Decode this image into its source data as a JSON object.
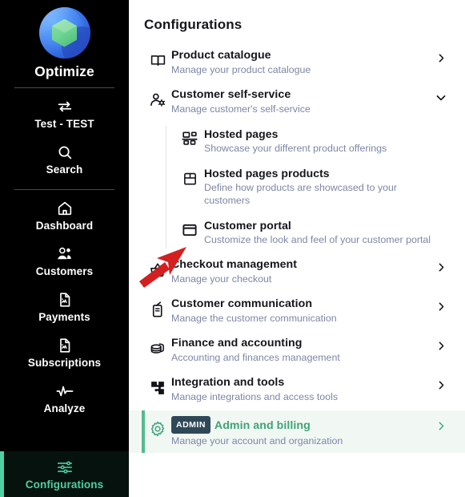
{
  "sidebar": {
    "brand": {
      "name": "Optimize",
      "logo_icon": "optimize-logo",
      "logo_colors": {
        "outer": "#3f7ff0",
        "inner": "#6ed592"
      }
    },
    "items": [
      {
        "label": "Test - TEST",
        "icon": "swap-arrows-icon",
        "active": false
      },
      {
        "label": "Search",
        "icon": "search-icon",
        "active": false
      },
      {
        "label": "Dashboard",
        "icon": "home-icon",
        "active": false
      },
      {
        "label": "Customers",
        "icon": "users-icon",
        "active": false
      },
      {
        "label": "Payments",
        "icon": "document-chart-icon",
        "active": false
      },
      {
        "label": "Subscriptions",
        "icon": "document-chart-icon",
        "active": false
      },
      {
        "label": "Analyze",
        "icon": "pulse-icon",
        "active": false
      },
      {
        "label": "Configurations",
        "icon": "sliders-icon",
        "active": true
      }
    ],
    "active_color": "#4fcfa4",
    "background": "#000000"
  },
  "main": {
    "title": "Configurations",
    "rows": [
      {
        "title": "Product catalogue",
        "subtitle": "Manage your product catalogue",
        "icon": "book-icon",
        "chevron": "chevron-right",
        "level": "top"
      },
      {
        "title": "Customer self-service",
        "subtitle": "Manage customer's self-service",
        "icon": "user-gear-icon",
        "chevron": "chevron-down",
        "level": "top"
      },
      {
        "title": "Hosted pages",
        "subtitle": "Showcase your different product offerings",
        "icon": "layout-blocks-icon",
        "chevron": "none",
        "level": "sub"
      },
      {
        "title": "Hosted pages products",
        "subtitle": "Define how products are showcased to your customers",
        "icon": "box-icon",
        "chevron": "none",
        "level": "sub"
      },
      {
        "title": "Customer portal",
        "subtitle": "Customize the look and feel of your customer portal",
        "icon": "browser-window-icon",
        "chevron": "none",
        "level": "sub"
      },
      {
        "title": "Checkout management",
        "subtitle": "Manage your checkout",
        "icon": "basket-icon",
        "chevron": "chevron-right",
        "level": "top"
      },
      {
        "title": "Customer communication",
        "subtitle": "Manage the customer communication",
        "icon": "radio-icon",
        "chevron": "chevron-right",
        "level": "top"
      },
      {
        "title": "Finance and accounting",
        "subtitle": "Accounting and finances management",
        "icon": "coins-stack-icon",
        "chevron": "chevron-right",
        "level": "top"
      },
      {
        "title": "Integration and tools",
        "subtitle": "Manage integrations and access tools",
        "icon": "puzzle-icon",
        "chevron": "chevron-right",
        "level": "top"
      },
      {
        "title": "Admin and billing",
        "subtitle": "Manage your account and organization",
        "badge": "ADMIN",
        "icon": "gear-icon",
        "chevron": "chevron-right",
        "level": "top",
        "highlighted": true
      }
    ],
    "subtitle_color": "#7e86a6",
    "highlight_bg": "#f1f8f4",
    "highlight_text": "#3fa377",
    "badge_bg": "#2f4858"
  },
  "annotation": {
    "arrow_color": "#d41f20",
    "points_to": "Customer portal"
  }
}
